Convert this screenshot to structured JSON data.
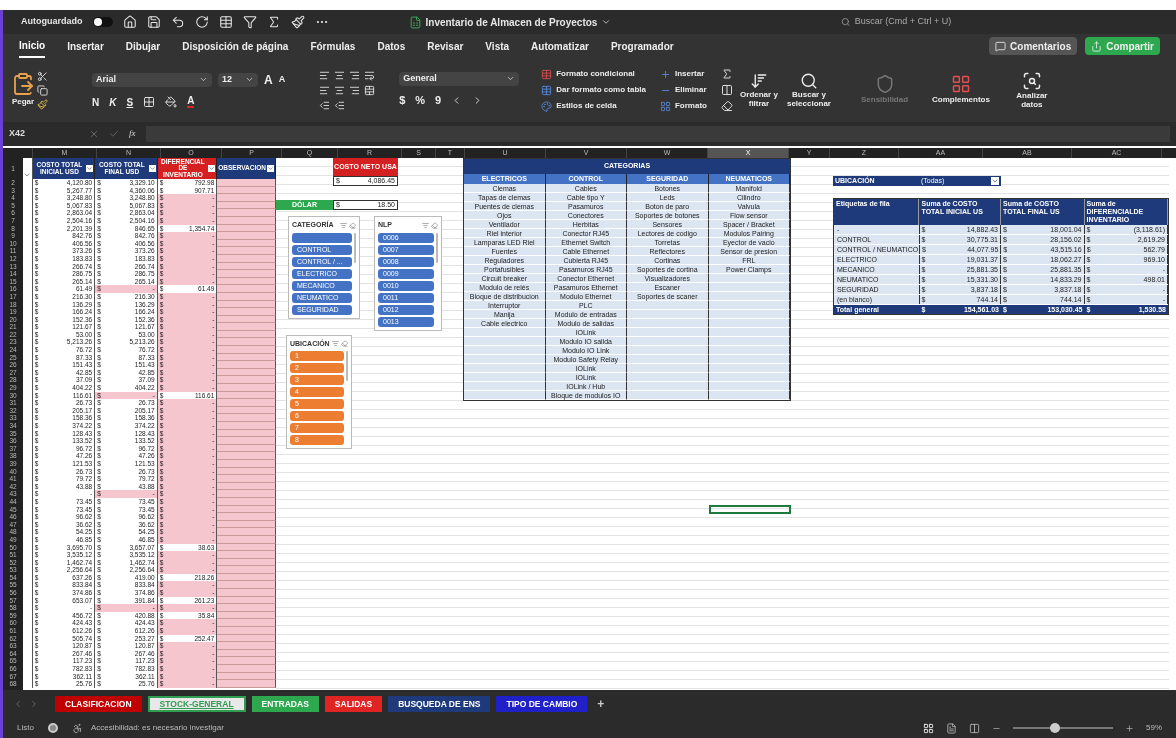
{
  "title_bar": {
    "autosave": {
      "label": "Autoguardado",
      "on": false
    },
    "title": "Inventario de Almacen de Proyectos",
    "search": {
      "placeholder": "Buscar (Cmd + Ctrl + U)"
    }
  },
  "menu": [
    {
      "label": "Inicio",
      "selected": true
    },
    {
      "label": "Insertar",
      "selected": false
    },
    {
      "label": "Dibujar",
      "selected": false
    },
    {
      "label": "Disposición de página",
      "selected": false
    },
    {
      "label": "Fórmulas",
      "selected": false
    },
    {
      "label": "Datos",
      "selected": false
    },
    {
      "label": "Revisar",
      "selected": false
    },
    {
      "label": "Vista",
      "selected": false
    },
    {
      "label": "Automatizar",
      "selected": false
    },
    {
      "label": "Programador",
      "selected": false
    }
  ],
  "comments": "Comentarios",
  "share": "Compartir",
  "ribbon": {
    "paste": "Pegar",
    "font": "Arial",
    "size": "12",
    "grow_font": "A",
    "shrink_font": "A",
    "bold": "N",
    "italic": "K",
    "underline": "S",
    "font_color": "A",
    "number_format": "General",
    "currency": "$",
    "percent": "%",
    "comma": "9",
    "conditional": "Formato condicional",
    "table_format": "Dar formato como tabla",
    "cell_styles": "Estilos de celda",
    "insert": "Insertar",
    "delete": "Eliminar",
    "format": "Formato",
    "sort": "Ordenar y filtrar",
    "find": "Buscar y seleccionar",
    "sensitivity": {
      "label": "Sensibilidad",
      "disabled": true
    },
    "addins": "Complementos",
    "analyze": "Analizar datos"
  },
  "formula_bar": {
    "cell_ref": "X42",
    "fx": "fx"
  },
  "columns": [
    {
      "label": "M",
      "selected": false
    },
    {
      "label": "N",
      "selected": false
    },
    {
      "label": "O",
      "selected": false
    },
    {
      "label": "P",
      "selected": false
    },
    {
      "label": "Q",
      "selected": false
    },
    {
      "label": "R",
      "selected": false
    },
    {
      "label": "S",
      "selected": false
    },
    {
      "label": "T",
      "selected": false
    },
    {
      "label": "U",
      "selected": false
    },
    {
      "label": "V",
      "selected": false
    },
    {
      "label": "W",
      "selected": false
    },
    {
      "label": "X",
      "selected": true
    },
    {
      "label": "Y",
      "selected": false
    },
    {
      "label": "Z",
      "selected": false
    },
    {
      "label": "AA",
      "selected": false
    },
    {
      "label": "AB",
      "selected": false
    },
    {
      "label": "AC",
      "selected": false
    }
  ],
  "stock_table": {
    "row_number": "1",
    "headers": [
      {
        "label": "COSTO TOTAL INICIAL USD",
        "color": "#1f3a7a"
      },
      {
        "label": "COSTO TOTAL FINAL USD",
        "color": "#1f3a7a"
      },
      {
        "label": "DIFERENCIAL DE INVENTARIO",
        "color": "#d42020"
      },
      {
        "label": "OBSERVACION",
        "color": "#1f3a7a"
      }
    ],
    "rows": [
      {
        "n": "2",
        "cells": [
          [
            "$",
            "4,120.80"
          ],
          [
            "$",
            "3,329.10"
          ],
          [
            "$",
            "792.98"
          ]
        ],
        "final_flag": false,
        "diff_flag": true
      },
      {
        "n": "3",
        "cells": [
          [
            "$",
            "5,267.77"
          ],
          [
            "$",
            "4,360.06"
          ],
          [
            "$",
            "907.71"
          ]
        ],
        "final_flag": false,
        "diff_flag": true
      },
      {
        "n": "4",
        "cells": [
          [
            "$",
            "3,248.80"
          ],
          [
            "$",
            "3,248.80"
          ],
          [
            "$",
            "-"
          ]
        ],
        "final_flag": false,
        "diff_flag": false
      },
      {
        "n": "5",
        "cells": [
          [
            "$",
            "5,067.83"
          ],
          [
            "$",
            "5,067.83"
          ],
          [
            "$",
            "-"
          ]
        ],
        "final_flag": false,
        "diff_flag": false
      },
      {
        "n": "6",
        "cells": [
          [
            "$",
            "2,863.04"
          ],
          [
            "$",
            "2,863.04"
          ],
          [
            "$",
            "-"
          ]
        ],
        "final_flag": false,
        "diff_flag": false
      },
      {
        "n": "7",
        "cells": [
          [
            "$",
            "2,504.16"
          ],
          [
            "$",
            "2,504.16"
          ],
          [
            "$",
            "-"
          ]
        ],
        "final_flag": false,
        "diff_flag": false
      },
      {
        "n": "8",
        "cells": [
          [
            "$",
            "2,201.39"
          ],
          [
            "$",
            "846.65"
          ],
          [
            "$",
            "1,354.74"
          ]
        ],
        "final_flag": false,
        "diff_flag": true
      },
      {
        "n": "9",
        "cells": [
          [
            "$",
            "842.76"
          ],
          [
            "$",
            "842.76"
          ],
          [
            "$",
            "-"
          ]
        ],
        "final_flag": false,
        "diff_flag": false
      },
      {
        "n": "10",
        "cells": [
          [
            "$",
            "406.56"
          ],
          [
            "$",
            "406.56"
          ],
          [
            "$",
            "-"
          ]
        ],
        "final_flag": false,
        "diff_flag": false
      },
      {
        "n": "11",
        "cells": [
          [
            "$",
            "373.26"
          ],
          [
            "$",
            "373.26"
          ],
          [
            "$",
            "-"
          ]
        ],
        "final_flag": false,
        "diff_flag": false
      },
      {
        "n": "12",
        "cells": [
          [
            "$",
            "183.83"
          ],
          [
            "$",
            "183.83"
          ],
          [
            "$",
            "-"
          ]
        ],
        "final_flag": false,
        "diff_flag": false
      },
      {
        "n": "13",
        "cells": [
          [
            "$",
            "266.74"
          ],
          [
            "$",
            "266.74"
          ],
          [
            "$",
            "-"
          ]
        ],
        "final_flag": false,
        "diff_flag": false
      },
      {
        "n": "14",
        "cells": [
          [
            "$",
            "286.75"
          ],
          [
            "$",
            "286.75"
          ],
          [
            "$",
            "-"
          ]
        ],
        "final_flag": false,
        "diff_flag": false
      },
      {
        "n": "15",
        "cells": [
          [
            "$",
            "265.14"
          ],
          [
            "$",
            "265.14"
          ],
          [
            "$",
            "-"
          ]
        ],
        "final_flag": false,
        "diff_flag": false
      },
      {
        "n": "16",
        "cells": [
          [
            "$",
            "61.49"
          ],
          [
            "$",
            "-"
          ],
          [
            "$",
            "61.49"
          ]
        ],
        "final_flag": true,
        "diff_flag": true
      },
      {
        "n": "17",
        "cells": [
          [
            "$",
            "216.30"
          ],
          [
            "$",
            "216.30"
          ],
          [
            "$",
            "-"
          ]
        ],
        "final_flag": false,
        "diff_flag": false
      },
      {
        "n": "18",
        "cells": [
          [
            "$",
            "136.29"
          ],
          [
            "$",
            "136.29"
          ],
          [
            "$",
            "-"
          ]
        ],
        "final_flag": false,
        "diff_flag": false
      },
      {
        "n": "19",
        "cells": [
          [
            "$",
            "166.24"
          ],
          [
            "$",
            "166.24"
          ],
          [
            "$",
            "-"
          ]
        ],
        "final_flag": false,
        "diff_flag": false
      },
      {
        "n": "20",
        "cells": [
          [
            "$",
            "152.36"
          ],
          [
            "$",
            "152.36"
          ],
          [
            "$",
            "-"
          ]
        ],
        "final_flag": false,
        "diff_flag": false
      },
      {
        "n": "21",
        "cells": [
          [
            "$",
            "121.67"
          ],
          [
            "$",
            "121.67"
          ],
          [
            "$",
            "-"
          ]
        ],
        "final_flag": false,
        "diff_flag": false
      },
      {
        "n": "22",
        "cells": [
          [
            "$",
            "53.00"
          ],
          [
            "$",
            "53.00"
          ],
          [
            "$",
            "-"
          ]
        ],
        "final_flag": false,
        "diff_flag": false
      },
      {
        "n": "23",
        "cells": [
          [
            "$",
            "5,213.26"
          ],
          [
            "$",
            "5,213.26"
          ],
          [
            "$",
            "-"
          ]
        ],
        "final_flag": false,
        "diff_flag": false
      },
      {
        "n": "24",
        "cells": [
          [
            "$",
            "76.72"
          ],
          [
            "$",
            "76.72"
          ],
          [
            "$",
            "-"
          ]
        ],
        "final_flag": false,
        "diff_flag": false
      },
      {
        "n": "25",
        "cells": [
          [
            "$",
            "87.33"
          ],
          [
            "$",
            "87.33"
          ],
          [
            "$",
            "-"
          ]
        ],
        "final_flag": false,
        "diff_flag": false
      },
      {
        "n": "26",
        "cells": [
          [
            "$",
            "151.43"
          ],
          [
            "$",
            "151.43"
          ],
          [
            "$",
            "-"
          ]
        ],
        "final_flag": false,
        "diff_flag": false
      },
      {
        "n": "27",
        "cells": [
          [
            "$",
            "42.85"
          ],
          [
            "$",
            "42.85"
          ],
          [
            "$",
            "-"
          ]
        ],
        "final_flag": false,
        "diff_flag": false
      },
      {
        "n": "28",
        "cells": [
          [
            "$",
            "37.09"
          ],
          [
            "$",
            "37.09"
          ],
          [
            "$",
            "-"
          ]
        ],
        "final_flag": false,
        "diff_flag": false
      },
      {
        "n": "29",
        "cells": [
          [
            "$",
            "404.22"
          ],
          [
            "$",
            "404.22"
          ],
          [
            "$",
            "-"
          ]
        ],
        "final_flag": false,
        "diff_flag": false
      },
      {
        "n": "30",
        "cells": [
          [
            "$",
            "116.61"
          ],
          [
            "$",
            "-"
          ],
          [
            "$",
            "116.61"
          ]
        ],
        "final_flag": true,
        "diff_flag": true
      },
      {
        "n": "31",
        "cells": [
          [
            "$",
            "26.73"
          ],
          [
            "$",
            "26.73"
          ],
          [
            "$",
            "-"
          ]
        ],
        "final_flag": false,
        "diff_flag": false
      },
      {
        "n": "32",
        "cells": [
          [
            "$",
            "205.17"
          ],
          [
            "$",
            "205.17"
          ],
          [
            "$",
            "-"
          ]
        ],
        "final_flag": false,
        "diff_flag": false
      },
      {
        "n": "33",
        "cells": [
          [
            "$",
            "158.36"
          ],
          [
            "$",
            "158.36"
          ],
          [
            "$",
            "-"
          ]
        ],
        "final_flag": false,
        "diff_flag": false
      },
      {
        "n": "34",
        "cells": [
          [
            "$",
            "374.22"
          ],
          [
            "$",
            "374.22"
          ],
          [
            "$",
            "-"
          ]
        ],
        "final_flag": false,
        "diff_flag": false
      },
      {
        "n": "35",
        "cells": [
          [
            "$",
            "128.43"
          ],
          [
            "$",
            "128.43"
          ],
          [
            "$",
            "-"
          ]
        ],
        "final_flag": false,
        "diff_flag": false
      },
      {
        "n": "36",
        "cells": [
          [
            "$",
            "133.52"
          ],
          [
            "$",
            "133.52"
          ],
          [
            "$",
            "-"
          ]
        ],
        "final_flag": false,
        "diff_flag": false
      },
      {
        "n": "37",
        "cells": [
          [
            "$",
            "96.72"
          ],
          [
            "$",
            "96.72"
          ],
          [
            "$",
            "-"
          ]
        ],
        "final_flag": false,
        "diff_flag": false
      },
      {
        "n": "38",
        "cells": [
          [
            "$",
            "47.26"
          ],
          [
            "$",
            "47.26"
          ],
          [
            "$",
            "-"
          ]
        ],
        "final_flag": false,
        "diff_flag": false
      },
      {
        "n": "39",
        "cells": [
          [
            "$",
            "121.53"
          ],
          [
            "$",
            "121.53"
          ],
          [
            "$",
            "-"
          ]
        ],
        "final_flag": false,
        "diff_flag": false
      },
      {
        "n": "40",
        "cells": [
          [
            "$",
            "26.73"
          ],
          [
            "$",
            "26.73"
          ],
          [
            "$",
            "-"
          ]
        ],
        "final_flag": false,
        "diff_flag": false
      },
      {
        "n": "41",
        "cells": [
          [
            "$",
            "79.72"
          ],
          [
            "$",
            "79.72"
          ],
          [
            "$",
            "-"
          ]
        ],
        "final_flag": false,
        "diff_flag": false
      },
      {
        "n": "42",
        "cells": [
          [
            "$",
            "43.88"
          ],
          [
            "$",
            "43.88"
          ],
          [
            "$",
            "-"
          ]
        ],
        "final_flag": false,
        "diff_flag": false
      },
      {
        "n": "43",
        "cells": [
          [
            "$",
            "-"
          ],
          [
            "$",
            "-"
          ],
          [
            "$",
            "-"
          ]
        ],
        "final_flag": true,
        "diff_flag": false
      },
      {
        "n": "44",
        "cells": [
          [
            "$",
            "73.45"
          ],
          [
            "$",
            "73.45"
          ],
          [
            "$",
            "-"
          ]
        ],
        "final_flag": false,
        "diff_flag": false
      },
      {
        "n": "45",
        "cells": [
          [
            "$",
            "73.45"
          ],
          [
            "$",
            "73.45"
          ],
          [
            "$",
            "-"
          ]
        ],
        "final_flag": false,
        "diff_flag": false
      },
      {
        "n": "46",
        "cells": [
          [
            "$",
            "96.62"
          ],
          [
            "$",
            "96.62"
          ],
          [
            "$",
            "-"
          ]
        ],
        "final_flag": false,
        "diff_flag": false
      },
      {
        "n": "47",
        "cells": [
          [
            "$",
            "36.62"
          ],
          [
            "$",
            "36.62"
          ],
          [
            "$",
            "-"
          ]
        ],
        "final_flag": false,
        "diff_flag": false
      },
      {
        "n": "48",
        "cells": [
          [
            "$",
            "54.25"
          ],
          [
            "$",
            "54.25"
          ],
          [
            "$",
            "-"
          ]
        ],
        "final_flag": false,
        "diff_flag": false
      },
      {
        "n": "49",
        "cells": [
          [
            "$",
            "46.85"
          ],
          [
            "$",
            "46.85"
          ],
          [
            "$",
            "-"
          ]
        ],
        "final_flag": false,
        "diff_flag": false
      },
      {
        "n": "50",
        "cells": [
          [
            "$",
            "3,695.70"
          ],
          [
            "$",
            "3,657.07"
          ],
          [
            "$",
            "38.63"
          ]
        ],
        "final_flag": false,
        "diff_flag": true
      },
      {
        "n": "51",
        "cells": [
          [
            "$",
            "3,535.12"
          ],
          [
            "$",
            "3,535.12"
          ],
          [
            "$",
            "-"
          ]
        ],
        "final_flag": false,
        "diff_flag": false
      },
      {
        "n": "52",
        "cells": [
          [
            "$",
            "1,462.74"
          ],
          [
            "$",
            "1,462.74"
          ],
          [
            "$",
            "-"
          ]
        ],
        "final_flag": false,
        "diff_flag": false
      },
      {
        "n": "53",
        "cells": [
          [
            "$",
            "2,256.64"
          ],
          [
            "$",
            "2,256.64"
          ],
          [
            "$",
            "-"
          ]
        ],
        "final_flag": false,
        "diff_flag": false
      },
      {
        "n": "54",
        "cells": [
          [
            "$",
            "637.26"
          ],
          [
            "$",
            "419.00"
          ],
          [
            "$",
            "218.26"
          ]
        ],
        "final_flag": false,
        "diff_flag": true
      },
      {
        "n": "55",
        "cells": [
          [
            "$",
            "833.84"
          ],
          [
            "$",
            "833.84"
          ],
          [
            "$",
            "-"
          ]
        ],
        "final_flag": false,
        "diff_flag": false
      },
      {
        "n": "56",
        "cells": [
          [
            "$",
            "374.86"
          ],
          [
            "$",
            "374.86"
          ],
          [
            "$",
            "-"
          ]
        ],
        "final_flag": false,
        "diff_flag": false
      },
      {
        "n": "57",
        "cells": [
          [
            "$",
            "653.07"
          ],
          [
            "$",
            "391.84"
          ],
          [
            "$",
            "261.23"
          ]
        ],
        "final_flag": false,
        "diff_flag": true
      },
      {
        "n": "58",
        "cells": [
          [
            "$",
            "-"
          ],
          [
            "$",
            "-"
          ],
          [
            "$",
            "-"
          ]
        ],
        "final_flag": true,
        "diff_flag": false
      },
      {
        "n": "59",
        "cells": [
          [
            "$",
            "456.72"
          ],
          [
            "$",
            "420.88"
          ],
          [
            "$",
            "35.84"
          ]
        ],
        "final_flag": false,
        "diff_flag": true
      },
      {
        "n": "60",
        "cells": [
          [
            "$",
            "424.43"
          ],
          [
            "$",
            "424.43"
          ],
          [
            "$",
            "-"
          ]
        ],
        "final_flag": false,
        "diff_flag": false
      },
      {
        "n": "61",
        "cells": [
          [
            "$",
            "612.26"
          ],
          [
            "$",
            "612.26"
          ],
          [
            "$",
            "-"
          ]
        ],
        "final_flag": false,
        "diff_flag": false
      },
      {
        "n": "62",
        "cells": [
          [
            "$",
            "505.74"
          ],
          [
            "$",
            "253.27"
          ],
          [
            "$",
            "252.47"
          ]
        ],
        "final_flag": false,
        "diff_flag": true
      },
      {
        "n": "63",
        "cells": [
          [
            "$",
            "120.87"
          ],
          [
            "$",
            "120.87"
          ],
          [
            "$",
            "-"
          ]
        ],
        "final_flag": false,
        "diff_flag": false
      },
      {
        "n": "64",
        "cells": [
          [
            "$",
            "267.46"
          ],
          [
            "$",
            "267.46"
          ],
          [
            "$",
            "-"
          ]
        ],
        "final_flag": false,
        "diff_flag": false
      },
      {
        "n": "65",
        "cells": [
          [
            "$",
            "117.23"
          ],
          [
            "$",
            "117.23"
          ],
          [
            "$",
            "-"
          ]
        ],
        "final_flag": false,
        "diff_flag": false
      },
      {
        "n": "66",
        "cells": [
          [
            "$",
            "782.83"
          ],
          [
            "$",
            "782.83"
          ],
          [
            "$",
            "-"
          ]
        ],
        "final_flag": false,
        "diff_flag": false
      },
      {
        "n": "67",
        "cells": [
          [
            "$",
            "362.11"
          ],
          [
            "$",
            "362.11"
          ],
          [
            "$",
            "-"
          ]
        ],
        "final_flag": false,
        "diff_flag": false
      },
      {
        "n": "68",
        "cells": [
          [
            "$",
            "25.76"
          ],
          [
            "$",
            "25.76"
          ],
          [
            "$",
            "-"
          ]
        ],
        "final_flag": false,
        "diff_flag": false
      }
    ]
  },
  "net_cost": {
    "label": "COSTO NETO USA",
    "currency": "$",
    "value": "4,086.45"
  },
  "dollar": {
    "label": "DÓLAR",
    "currency": "$",
    "value": "18.50"
  },
  "slicers": [
    {
      "title": "CATEGORÍA",
      "color": "#4472c4",
      "items": [
        {
          "kind": "blank"
        },
        {
          "kind": "value",
          "label": "CONTROL"
        },
        {
          "kind": "value",
          "label": "CONTROL / ..."
        },
        {
          "kind": "value",
          "label": "ELECTRICO"
        },
        {
          "kind": "value",
          "label": "MECANICO"
        },
        {
          "kind": "value",
          "label": "NEUMATICO"
        },
        {
          "kind": "value",
          "label": "SEGURIDAD"
        }
      ]
    },
    {
      "title": "NLP",
      "color": "#4472c4",
      "items": [
        {
          "kind": "value",
          "label": "0006"
        },
        {
          "kind": "value",
          "label": "0007"
        },
        {
          "kind": "value",
          "label": "0008"
        },
        {
          "kind": "value",
          "label": "0009"
        },
        {
          "kind": "value",
          "label": "0010"
        },
        {
          "kind": "value",
          "label": "0011"
        },
        {
          "kind": "value",
          "label": "0012"
        },
        {
          "kind": "value",
          "label": "0013"
        }
      ]
    },
    {
      "title": "UBICACIÓN",
      "color": "#ed7d31",
      "items": [
        {
          "kind": "value",
          "label": "1"
        },
        {
          "kind": "value",
          "label": "2"
        },
        {
          "kind": "value",
          "label": "3"
        },
        {
          "kind": "value",
          "label": "4"
        },
        {
          "kind": "value",
          "label": "5"
        },
        {
          "kind": "value",
          "label": "6"
        },
        {
          "kind": "value",
          "label": "7"
        },
        {
          "kind": "value",
          "label": "8"
        }
      ]
    }
  ],
  "categories": {
    "title": "CATEGORIAS",
    "headers": [
      "ELECTRICOS",
      "CONTROL",
      "SEGURIDAD",
      "NEUMATICOS"
    ],
    "rows": [
      [
        "Clemas",
        "Cables",
        "Botones",
        "Manifold"
      ],
      [
        "Tapas de clemas",
        "Cable tipo Y",
        "Leds",
        "Cilindro"
      ],
      [
        "Puentes de clemas",
        "Pasamuros",
        "Boton de paro",
        "Valvula"
      ],
      [
        "Ojos",
        "Conectores",
        "Soportes de botones",
        "Flow sensor"
      ],
      [
        "Ventilador",
        "Herbitas",
        "Sensores",
        "Spacer / Bracket"
      ],
      [
        "Riel interior",
        "Conector RJ45",
        "Lectores de codigo",
        "Modulos Pairing"
      ],
      [
        "Lamparas LED Riel",
        "Ethernet Switch",
        "Torretas",
        "Eyector de vacio"
      ],
      [
        "Fuentes",
        "Cable Ethernet",
        "Reflectores",
        "Sensor de presion"
      ],
      [
        "Reguladores",
        "Cubierta RJ45",
        "Cortinas",
        "FRL"
      ],
      [
        "Portafusibles",
        "Pasamuros RJ45",
        "Soportes de cortina",
        "Power Clamps"
      ],
      [
        "Circuit breaker",
        "Conector Ethernet",
        "Visualizadores",
        null
      ],
      [
        "Modulo de relés",
        "Pasamuros Ethernet",
        "Escaner",
        null
      ],
      [
        "Bloque de distribucion",
        "Modulo Ethernet",
        "Soportes de scaner",
        null
      ],
      [
        "Interruptor",
        "PLC",
        null,
        null
      ],
      [
        "Manija",
        "Modulo de entradas",
        null,
        null
      ],
      [
        "Cable electrico",
        "Modulo de salidas",
        null,
        null
      ],
      [
        null,
        "IOLink",
        null,
        null
      ],
      [
        null,
        "Modulo IO salida",
        null,
        null
      ],
      [
        null,
        "Modulo IO Link",
        null,
        null
      ],
      [
        null,
        "Modulo Safety Relay",
        null,
        null
      ],
      [
        null,
        "IOLink",
        null,
        null
      ],
      [
        null,
        "IOLink",
        null,
        null
      ],
      [
        null,
        "IOLink / Hub",
        null,
        null
      ],
      [
        null,
        "Bloque de modulos IO",
        null,
        null
      ]
    ]
  },
  "pivot": {
    "filter_label": "UBICACIÓN",
    "filter_value": "(Todas)",
    "headers": [
      "Etiquetas de fila",
      "Suma de COSTO TOTAL INICIAL US",
      "Suma de COSTO TOTAL FINAL US",
      "Suma de DIFERENCIALDE INVENTARIO"
    ],
    "rows": [
      {
        "label": "-",
        "values": [
          [
            "$",
            "14,882.43"
          ],
          [
            "$",
            "18,001.04"
          ],
          [
            "$",
            "(3,118.61)"
          ]
        ]
      },
      {
        "label": "CONTROL",
        "values": [
          [
            "$",
            "30,775.31"
          ],
          [
            "$",
            "28,156.02"
          ],
          [
            "$",
            "2,619.29"
          ]
        ]
      },
      {
        "label": "CONTROL / NEUMATICO",
        "values": [
          [
            "$",
            "44,077.95"
          ],
          [
            "$",
            "43,515.16"
          ],
          [
            "$",
            "562.79"
          ]
        ]
      },
      {
        "label": "ELECTRICO",
        "values": [
          [
            "$",
            "19,031.37"
          ],
          [
            "$",
            "18,062.27"
          ],
          [
            "$",
            "969.10"
          ]
        ]
      },
      {
        "label": "MECANICO",
        "values": [
          [
            "$",
            "25,881.35"
          ],
          [
            "$",
            "25,881.35"
          ],
          [
            "$",
            "-"
          ]
        ]
      },
      {
        "label": "NEUMATICO",
        "values": [
          [
            "$",
            "15,331.30"
          ],
          [
            "$",
            "14,833.29"
          ],
          [
            "$",
            "498.01"
          ]
        ]
      },
      {
        "label": "SEGURIDAD",
        "values": [
          [
            "$",
            "3,837.18"
          ],
          [
            "$",
            "3,837.18"
          ],
          [
            "$",
            "-"
          ]
        ]
      },
      {
        "label": "(en blanco)",
        "values": [
          [
            "$",
            "744.14"
          ],
          [
            "$",
            "744.14"
          ],
          [
            "$",
            "-"
          ]
        ]
      }
    ],
    "total": {
      "label": "Total general",
      "values": [
        [
          "$",
          "154,561.03"
        ],
        [
          "$",
          "153,030.45"
        ],
        [
          "$",
          "1,530.58"
        ]
      ]
    }
  },
  "sheet_tabs": [
    {
      "label": "CLASIFICACION",
      "color": "#c00000",
      "selected": false
    },
    {
      "label": "STOCK-GENERAL",
      "color": "#2f9e50",
      "selected": true
    },
    {
      "label": "ENTRADAS",
      "color": "#2ea84f",
      "selected": false
    },
    {
      "label": "SALIDAS",
      "color": "#e02424",
      "selected": false
    },
    {
      "label": "BUSQUEDA DE ENS",
      "color": "#1f3a7a",
      "selected": false
    },
    {
      "label": "TIPO DE CAMBIO",
      "color": "#2020c8",
      "selected": false
    }
  ],
  "add_sheet": "+",
  "status_bar": {
    "ready": "Listo",
    "accessibility": "Accesibilidad: es necesario investigar",
    "zoom": {
      "level": 0.42,
      "reading": "59%"
    }
  }
}
